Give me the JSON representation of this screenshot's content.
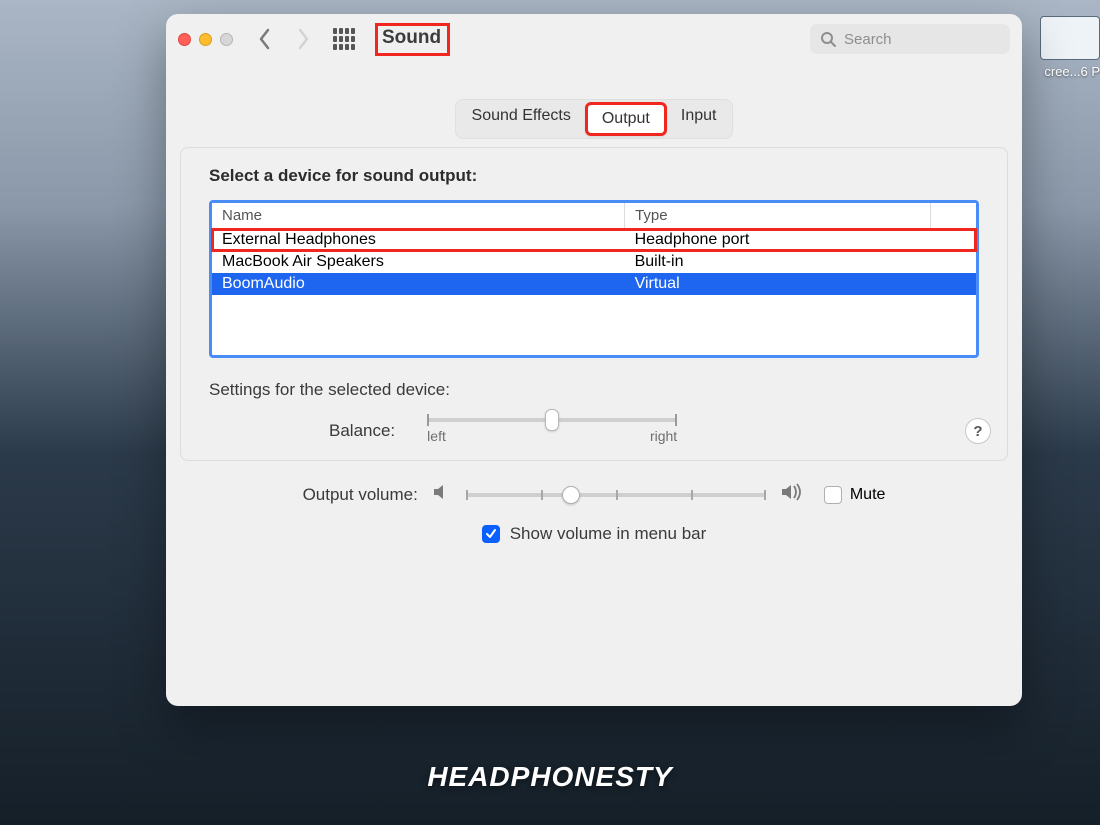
{
  "desktop": {
    "thumb_label": "cree...6 P"
  },
  "window": {
    "title": "Sound",
    "search_placeholder": "Search"
  },
  "tabs": {
    "items": [
      "Sound Effects",
      "Output",
      "Input"
    ],
    "selected_index": 1,
    "highlighted_index": 1
  },
  "panel": {
    "heading": "Select a device for sound output:",
    "columns": {
      "name": "Name",
      "type": "Type"
    },
    "devices": [
      {
        "name": "External Headphones",
        "type": "Headphone port",
        "selected": false,
        "highlighted": true
      },
      {
        "name": "MacBook Air Speakers",
        "type": "Built-in",
        "selected": false,
        "highlighted": false
      },
      {
        "name": "BoomAudio",
        "type": "Virtual",
        "selected": true,
        "highlighted": false
      }
    ],
    "settings_heading": "Settings for the selected device:",
    "balance": {
      "label": "Balance:",
      "left_label": "left",
      "right_label": "right",
      "value_percent": 50
    },
    "help_label": "?"
  },
  "volume": {
    "label": "Output volume:",
    "value_percent": 35,
    "mute_label": "Mute",
    "mute_checked": false,
    "show_in_menubar_label": "Show volume in menu bar",
    "show_in_menubar_checked": true
  },
  "watermark": "HEADPHONESTY",
  "annotations": {
    "title_boxed": true,
    "device_table_boxed": true
  }
}
